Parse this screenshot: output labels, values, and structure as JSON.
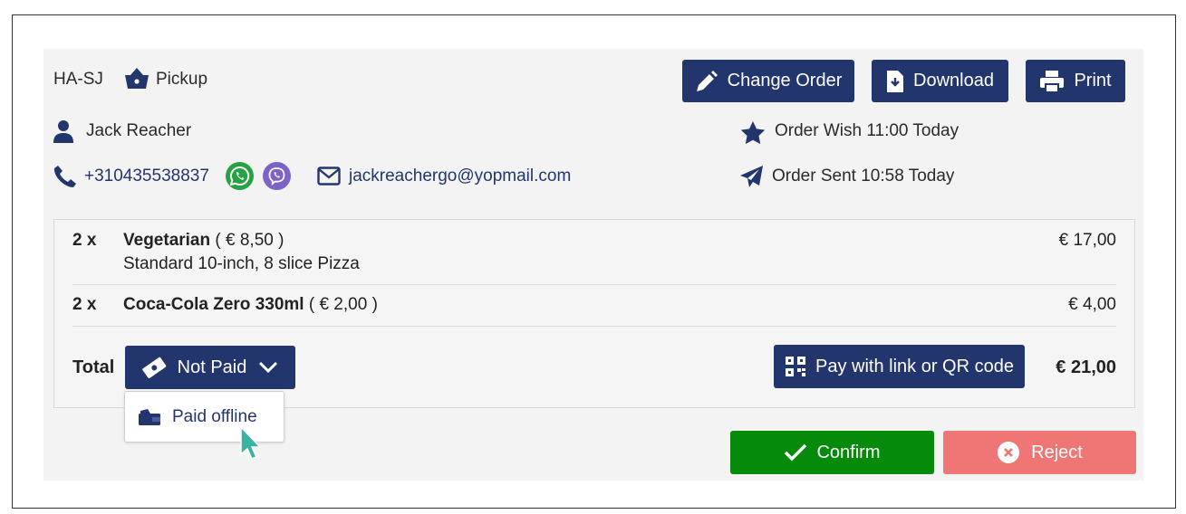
{
  "order": {
    "code": "HA-SJ",
    "type_label": "Pickup"
  },
  "actions": {
    "change_order": "Change Order",
    "download": "Download",
    "print": "Print"
  },
  "customer": {
    "name": "Jack Reacher",
    "phone": "+310435538837",
    "email": "jackreachergo@yopmail.com"
  },
  "timing": {
    "wish": "Order Wish 11:00 Today",
    "sent": "Order Sent 10:58 Today"
  },
  "items": [
    {
      "qty": "2 x",
      "name": "Vegetarian",
      "unit_price": "( € 8,50 )",
      "description": "Standard 10-inch, 8 slice Pizza",
      "total": "€ 17,00"
    },
    {
      "qty": "2 x",
      "name": "Coca-Cola Zero 330ml",
      "unit_price": "( € 2,00 )",
      "total": "€ 4,00"
    }
  ],
  "summary": {
    "total_label": "Total",
    "payment_status": "Not Paid",
    "pay_link_label": "Pay with link or QR code",
    "total_amount": "€ 21,00"
  },
  "payment_menu": {
    "options": [
      "Paid offline"
    ]
  },
  "footer": {
    "confirm": "Confirm",
    "reject": "Reject"
  },
  "icons": {
    "basket": "basket-icon",
    "user": "user-icon",
    "phone": "phone-icon",
    "whatsapp": "whatsapp-icon",
    "viber": "viber-icon",
    "email": "envelope-icon",
    "star": "star-icon",
    "sent": "paper-plane-icon",
    "pencil": "pencil-icon",
    "download": "file-download-icon",
    "print": "printer-icon",
    "money": "money-icon",
    "chevron": "chevron-down-icon",
    "qr": "qr-code-icon",
    "cash": "cash-icon",
    "check": "check-icon",
    "close": "close-circle-icon",
    "cursor": "pointer-cursor-icon"
  },
  "colors": {
    "navy": "#23356d",
    "confirm_green": "#058a0c",
    "reject_red": "#f07575",
    "whatsapp_green": "#25a244",
    "viber_purple": "#7d62c9",
    "cursor_teal": "#3bb3a3"
  }
}
